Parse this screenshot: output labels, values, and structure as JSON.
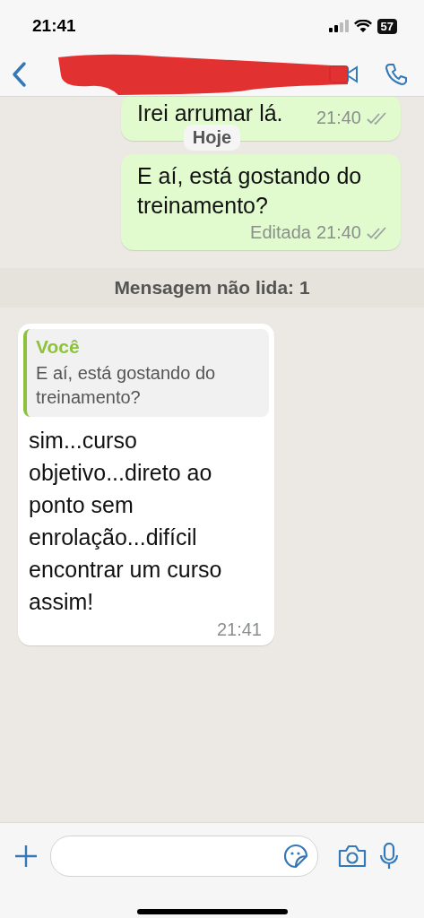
{
  "status_bar": {
    "time": "21:41",
    "battery": "57"
  },
  "header": {
    "redacted": true
  },
  "date_pill": "Hoje",
  "messages": [
    {
      "kind": "outgoing",
      "text": "Irei arrumar lá.",
      "time": "21:40",
      "read": false
    },
    {
      "kind": "outgoing",
      "text": "E aí, está gostando do treinamento?",
      "edited_label": "Editada",
      "time": "21:40",
      "read": false
    },
    {
      "kind": "unread_divider",
      "text": "Mensagem não lida: 1"
    },
    {
      "kind": "incoming",
      "quote": {
        "author": "Você",
        "text": "E aí, está gostando do treinamento?"
      },
      "text": "sim...curso objetivo...direto ao ponto sem enrolação...difícil encontrar um curso assim!",
      "time": "21:41"
    }
  ]
}
